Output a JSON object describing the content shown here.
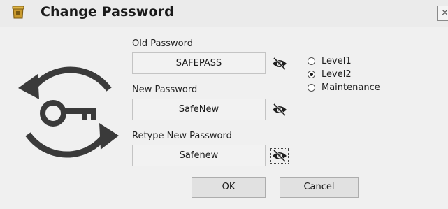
{
  "window": {
    "title": "Change Password",
    "close_glyph": "×"
  },
  "form": {
    "old_password": {
      "label": "Old Password",
      "value": "SAFEPASS"
    },
    "new_password": {
      "label": "New Password",
      "value": "SafeNew"
    },
    "retype_password": {
      "label": "Retype New Password",
      "value": "Safenew"
    }
  },
  "levels": {
    "options": [
      {
        "label": "Level1",
        "checked": false
      },
      {
        "label": "Level2",
        "checked": true
      },
      {
        "label": "Maintenance",
        "checked": false
      }
    ]
  },
  "buttons": {
    "ok_label": "OK",
    "cancel_label": "Cancel"
  },
  "icons": {
    "app": "app-icon",
    "graphic": "key-rotate-icon",
    "toggle": "eye-slash-icon"
  },
  "colors": {
    "dialog_bg": "#f0f0f0",
    "icon_dark": "#3a3a3a",
    "app_icon": "#c99a2e"
  }
}
